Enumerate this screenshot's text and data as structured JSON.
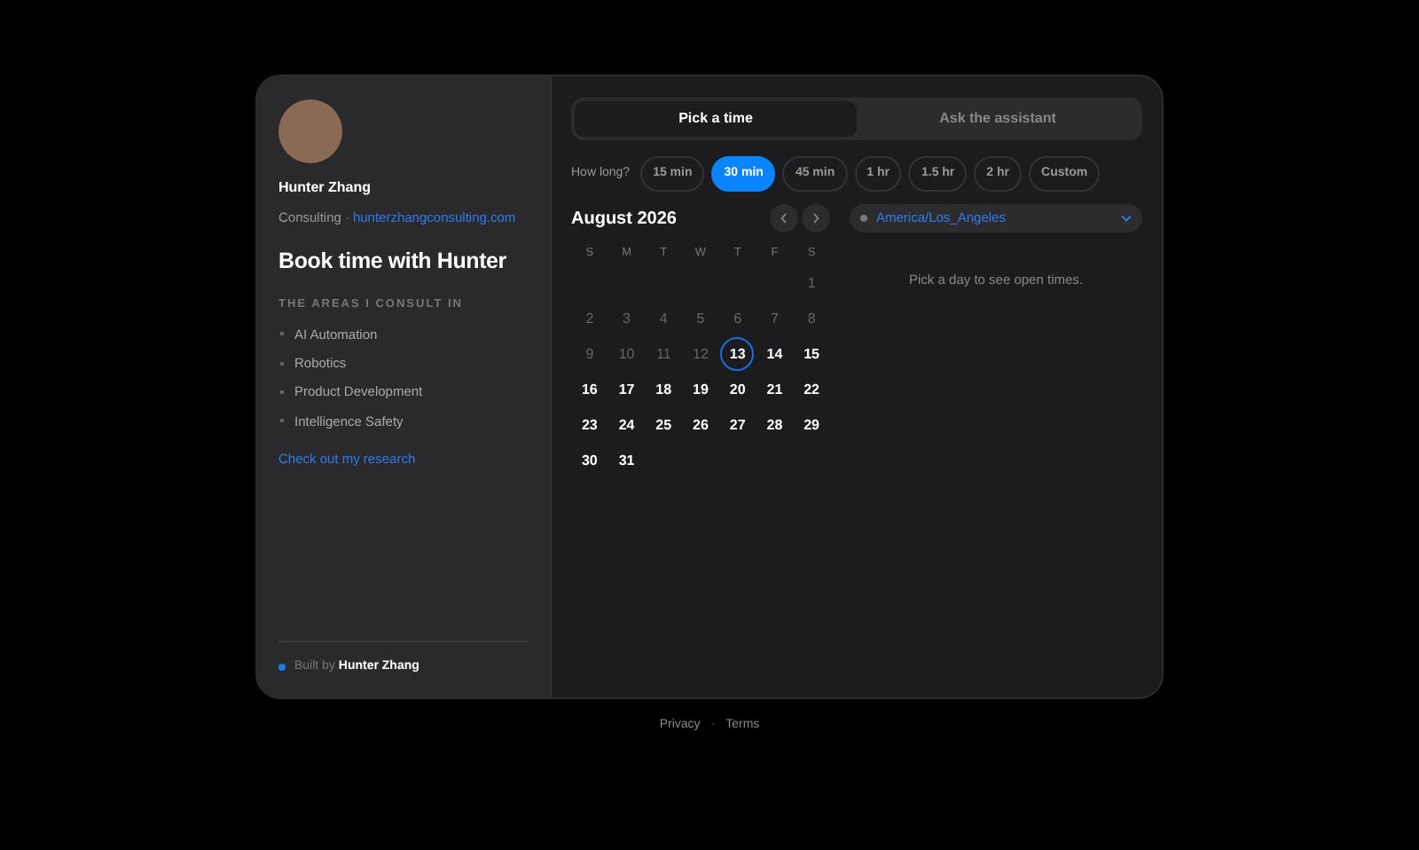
{
  "profile": {
    "name": "Hunter Zhang",
    "role": "Consulting",
    "separator": "·",
    "website": "hunterzhangconsulting.com"
  },
  "heading": "Book time with Hunter",
  "areas": {
    "title": "THE AREAS I CONSULT IN",
    "items": [
      "AI Automation",
      "Robotics",
      "Product Development",
      "Intelligence Safety"
    ]
  },
  "research_link": "Check out my research",
  "built_by": "Built by **Hunter Zhang**",
  "tabs": [
    {
      "label": "Pick a time",
      "selected": true
    },
    {
      "label": "Ask the assistant",
      "selected": false
    }
  ],
  "duration": {
    "label": "How long?",
    "options": [
      {
        "label": "15 min",
        "selected": false
      },
      {
        "label": "30 min",
        "selected": true
      },
      {
        "label": "45 min",
        "selected": false
      },
      {
        "label": "1 hr",
        "selected": false
      },
      {
        "label": "1.5 hr",
        "selected": false
      },
      {
        "label": "2 hr",
        "selected": false
      },
      {
        "label": "Custom",
        "selected": false
      }
    ]
  },
  "calendar": {
    "month": "August 2026",
    "weekdays": [
      "S",
      "M",
      "T",
      "W",
      "T",
      "F",
      "S"
    ],
    "weeks": [
      [
        {
          "day": "1",
          "available": false,
          "today": false
        }
      ],
      [
        {
          "day": "2",
          "available": false,
          "today": false
        },
        {
          "day": "3",
          "available": false,
          "today": false
        },
        {
          "day": "4",
          "available": false,
          "today": false
        },
        {
          "day": "5",
          "available": false,
          "today": false
        },
        {
          "day": "6",
          "available": false,
          "today": false
        },
        {
          "day": "7",
          "available": false,
          "today": false
        },
        {
          "day": "8",
          "available": false,
          "today": false
        }
      ],
      [
        {
          "day": "9",
          "available": false,
          "today": false
        },
        {
          "day": "10",
          "available": false,
          "today": false
        },
        {
          "day": "11",
          "available": false,
          "today": false
        },
        {
          "day": "12",
          "available": false,
          "today": false
        },
        {
          "day": "13",
          "available": true,
          "today": true
        },
        {
          "day": "14",
          "available": true,
          "today": false
        },
        {
          "day": "15",
          "available": true,
          "today": false
        }
      ],
      [
        {
          "day": "16",
          "available": true,
          "today": false
        },
        {
          "day": "17",
          "available": true,
          "today": false
        },
        {
          "day": "18",
          "available": true,
          "today": false
        },
        {
          "day": "19",
          "available": true,
          "today": false
        },
        {
          "day": "20",
          "available": true,
          "today": false
        },
        {
          "day": "21",
          "available": true,
          "today": false
        },
        {
          "day": "22",
          "available": true,
          "today": false
        }
      ],
      [
        {
          "day": "23",
          "available": true,
          "today": false
        },
        {
          "day": "24",
          "available": true,
          "today": false
        },
        {
          "day": "25",
          "available": true,
          "today": false
        },
        {
          "day": "26",
          "available": true,
          "today": false
        },
        {
          "day": "27",
          "available": true,
          "today": false
        },
        {
          "day": "28",
          "available": true,
          "today": false
        },
        {
          "day": "29",
          "available": true,
          "today": false
        }
      ],
      [
        {
          "day": "30",
          "available": true,
          "today": false
        },
        {
          "day": "31",
          "available": true,
          "today": false
        }
      ]
    ]
  },
  "timezone": "America/Los_Angeles",
  "times_hint": "Pick a day to see open times.",
  "footer": {
    "links": [
      "Privacy",
      "Terms"
    ],
    "separator": "·"
  }
}
